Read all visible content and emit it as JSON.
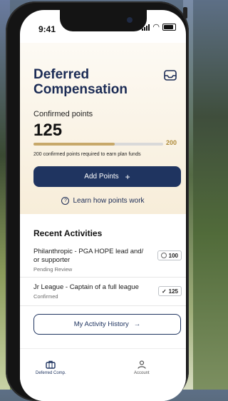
{
  "status_bar": {
    "time": "9:41"
  },
  "header": {
    "title": "Deferred Compensation"
  },
  "points": {
    "label": "Confirmed points",
    "value": "125",
    "goal": "200",
    "progress_fraction": 0.625,
    "requirement_text": "200 confirmed points required to earn plan funds"
  },
  "actions": {
    "add_points_label": "Add Points",
    "add_points_icon": "+",
    "learn_label": "Learn how points work"
  },
  "recent": {
    "title": "Recent Activities",
    "items": [
      {
        "title": "Philanthropic - PGA HOPE lead and/ or supporter",
        "status": "Pending Review",
        "points": "100",
        "badge_icon": "clock-icon"
      },
      {
        "title": "Jr League - Captain of a full league",
        "status": "Confirmed",
        "points": "125",
        "badge_icon": "check-icon"
      }
    ],
    "history_label": "My Activity History",
    "history_arrow": "→"
  },
  "tabs": [
    {
      "label": "Deferred Comp.",
      "icon": "briefcase-icon",
      "active": true
    },
    {
      "label": "Account",
      "icon": "person-icon",
      "active": false
    }
  ],
  "colors": {
    "primary": "#1f3460",
    "accent_gold": "#c7a86a",
    "hero_bg": "#f7edd9"
  }
}
